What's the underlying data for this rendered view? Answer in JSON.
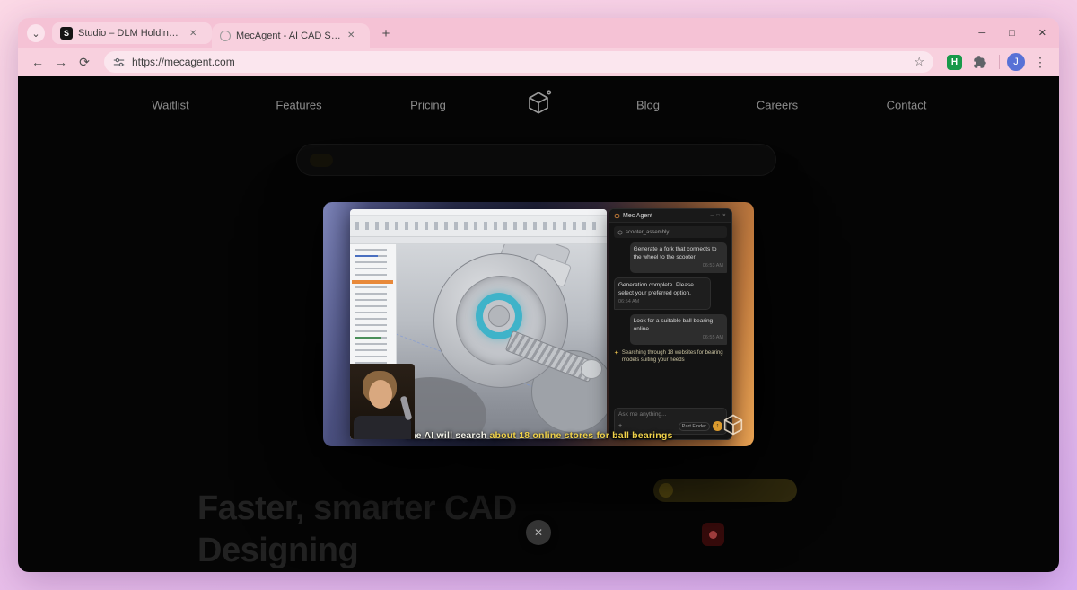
{
  "browser": {
    "tab_search_icon": "⌄",
    "tabs": [
      {
        "title": "Studio – DLM Holdings | Sanity",
        "close": "✕"
      },
      {
        "title": "MecAgent - AI CAD Sofware Co",
        "close": "✕"
      }
    ],
    "new_tab_icon": "+",
    "window_controls": {
      "minimize": "─",
      "maximize": "□",
      "close": "✕"
    },
    "toolbar": {
      "back": "←",
      "forward": "→",
      "reload": "⟳",
      "url": "https://mecagent.com",
      "star": "☆",
      "extension_letter": "H",
      "avatar_initial": "J",
      "menu": "⋮"
    }
  },
  "site": {
    "nav": {
      "items": [
        "Waitlist",
        "Features",
        "Pricing",
        "Blog",
        "Careers",
        "Contact"
      ]
    },
    "hero": {
      "line1": "Faster, smarter CAD",
      "line2": "Designing"
    },
    "close_button": "✕"
  },
  "video": {
    "caption": {
      "part1": "The AI will search",
      "part2": "about 18 online stores for ball bearings"
    },
    "chat": {
      "app_title": "Mec Agent",
      "window_controls": "─ □ ✕",
      "file_chip": "scooter_assembly",
      "messages": [
        {
          "text": "Generate a fork that connects to the wheel to the scooter",
          "time": "06:53 AM"
        },
        {
          "text": "Generation complete. Please select your preferred option.",
          "time": "06:54 AM"
        },
        {
          "text": "Look for a suitable ball bearing online",
          "time": "06:55 AM"
        }
      ],
      "status": {
        "icon": "✦",
        "text": "Searching through 18 websites for bearing models suiting your needs"
      },
      "input_placeholder": "Ask me anything...",
      "attach_icon": "+",
      "part_finder_label": "Part Finder",
      "send_icon": "↑"
    }
  }
}
